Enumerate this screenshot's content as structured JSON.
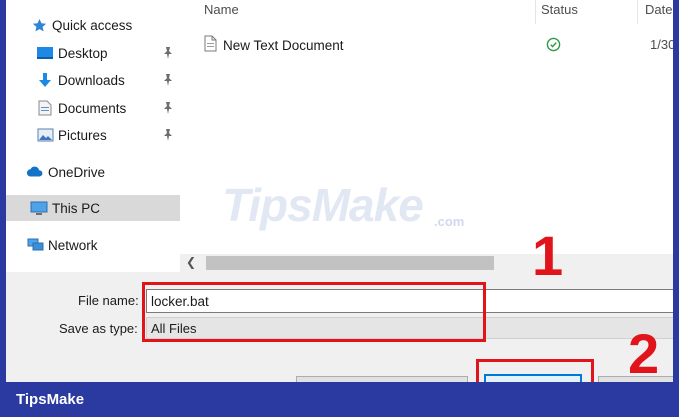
{
  "sidebar": {
    "items": [
      {
        "label": "Quick access",
        "icon": "star-icon",
        "pinned": false
      },
      {
        "label": "Desktop",
        "icon": "desktop-folder-icon",
        "pinned": true
      },
      {
        "label": "Downloads",
        "icon": "download-arrow-icon",
        "pinned": true
      },
      {
        "label": "Documents",
        "icon": "documents-icon",
        "pinned": true
      },
      {
        "label": "Pictures",
        "icon": "pictures-icon",
        "pinned": true
      },
      {
        "label": "OneDrive",
        "icon": "cloud-icon",
        "pinned": false
      },
      {
        "label": "This PC",
        "icon": "computer-icon",
        "pinned": false,
        "selected": true
      },
      {
        "label": "Network",
        "icon": "network-icon",
        "pinned": false
      }
    ]
  },
  "file_list": {
    "columns": [
      "Name",
      "Status",
      "Date"
    ],
    "rows": [
      {
        "name": "New Text Document",
        "status": "synced",
        "date": "1/30"
      }
    ]
  },
  "save_panel": {
    "filename_label": "File name:",
    "filename_value": "locker.bat",
    "type_label": "Save as type:",
    "type_value": "All Files"
  },
  "annotations": {
    "step1": "1",
    "step2": "2"
  },
  "watermark": {
    "text": "TipsMake",
    "suffix": ".com"
  },
  "footer": {
    "brand": "TipsMake"
  },
  "colors": {
    "frame": "#2b3aa0",
    "highlight": "#e0141a",
    "accent": "#0078d7",
    "folder": "#0c7cd5"
  }
}
